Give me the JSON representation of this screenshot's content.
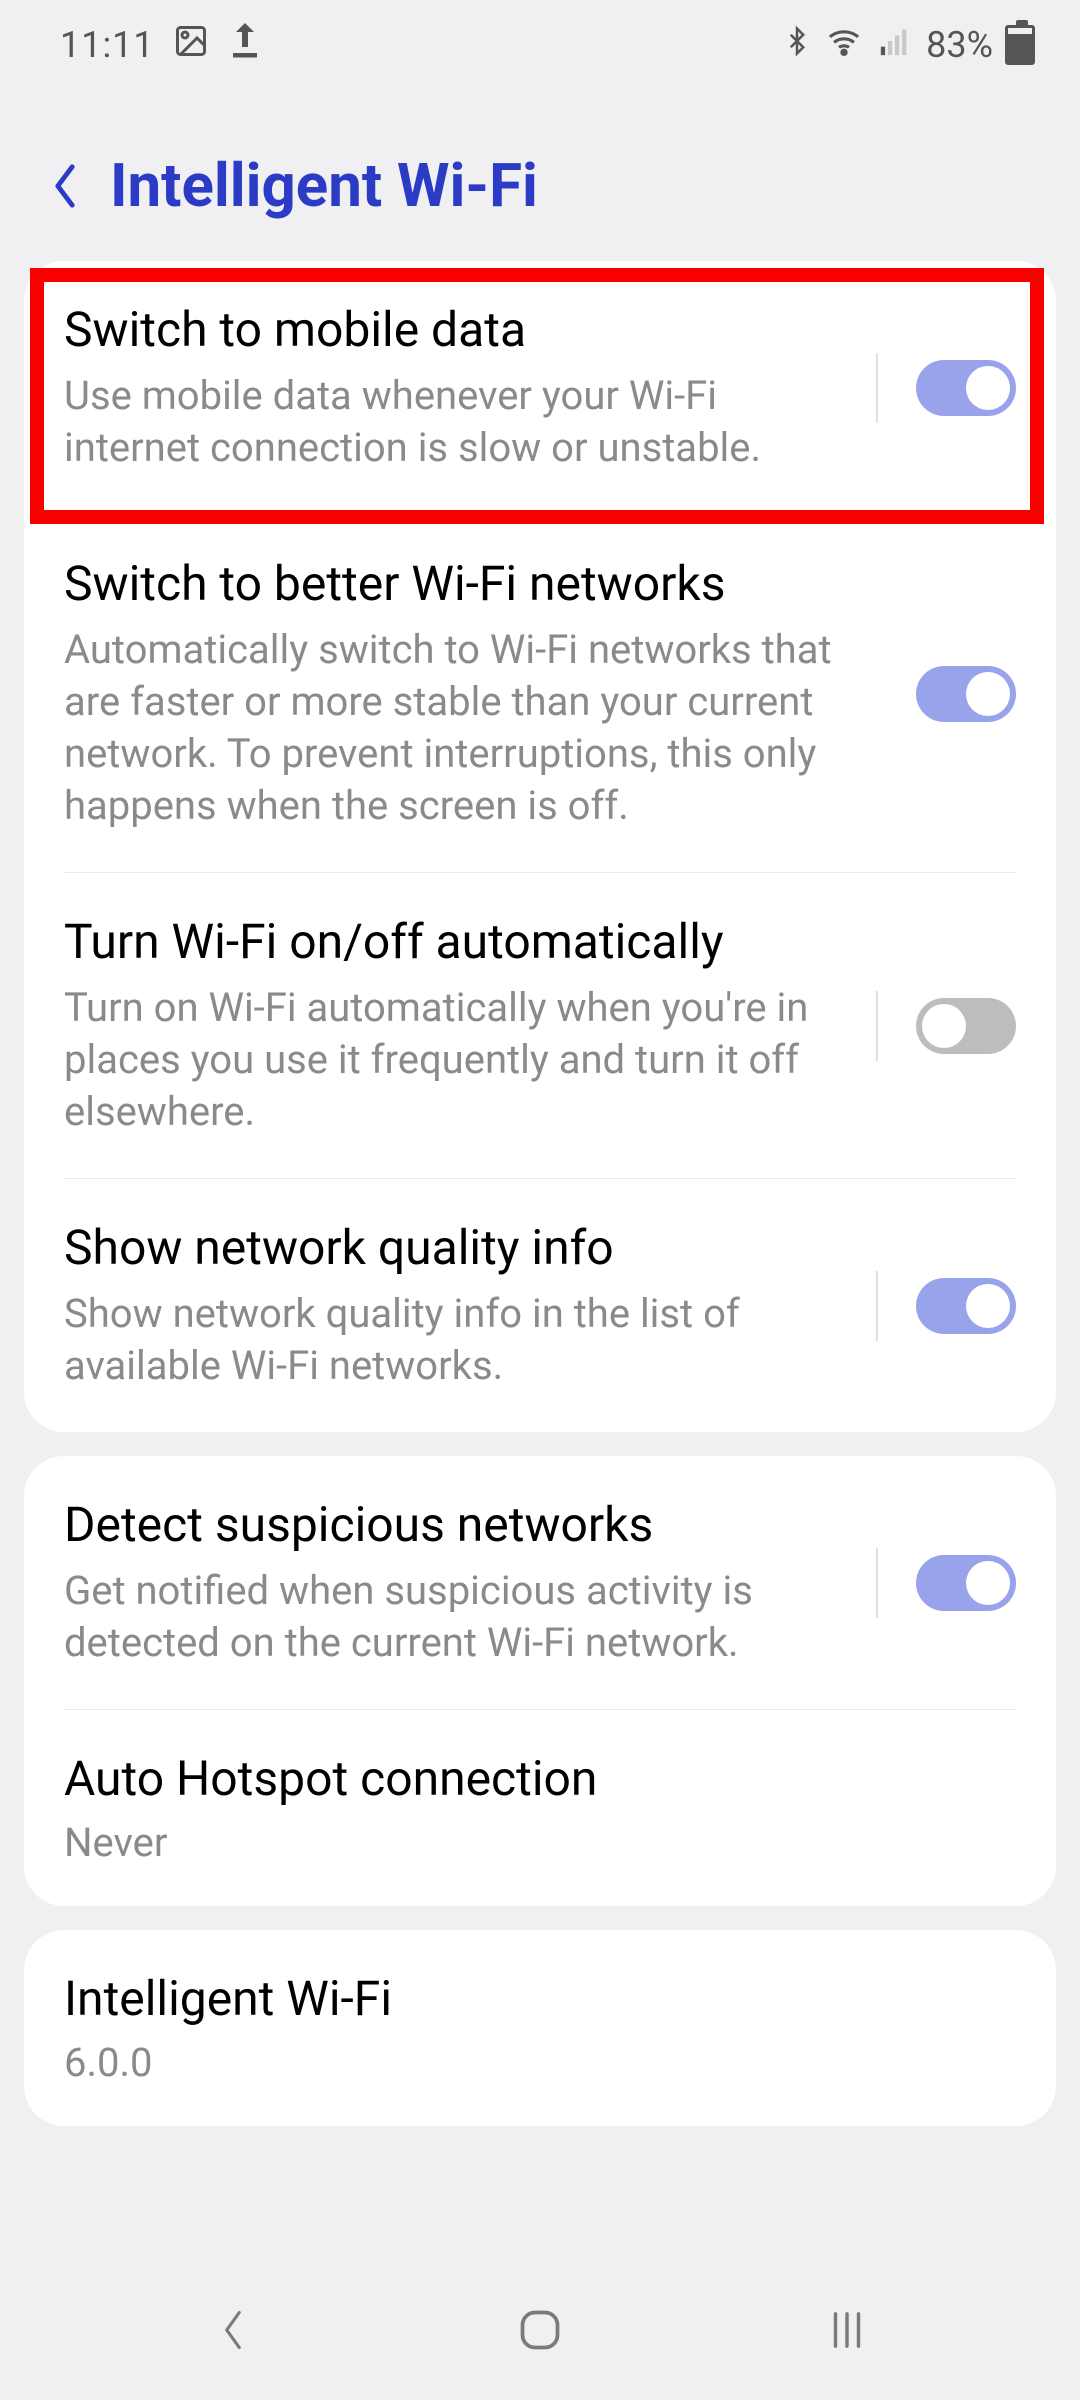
{
  "status": {
    "time": "11:11",
    "battery_pct": "83%"
  },
  "header": {
    "title": "Intelligent Wi-Fi"
  },
  "group1": {
    "items": [
      {
        "title": "Switch to mobile data",
        "desc": "Use mobile data whenever your Wi-Fi internet connection is slow or unstable.",
        "toggle": true
      },
      {
        "title": "Switch to better Wi-Fi networks",
        "desc": "Automatically switch to Wi-Fi networks that are faster or more stable than your current network. To prevent interruptions, this only happens when the screen is off.",
        "toggle": true
      },
      {
        "title": "Turn Wi-Fi on/off automatically",
        "desc": "Turn on Wi-Fi automatically when you're in places you use it frequently and turn it off elsewhere.",
        "toggle": false
      },
      {
        "title": "Show network quality info",
        "desc": "Show network quality info in the list of available Wi-Fi networks.",
        "toggle": true
      }
    ]
  },
  "group2": {
    "items": [
      {
        "title": "Detect suspicious networks",
        "desc": "Get notified when suspicious activity is detected on the current Wi-Fi network.",
        "toggle": true
      },
      {
        "title": "Auto Hotspot connection",
        "value": "Never"
      }
    ]
  },
  "group3": {
    "title": "Intelligent Wi-Fi",
    "version": "6.0.0"
  }
}
